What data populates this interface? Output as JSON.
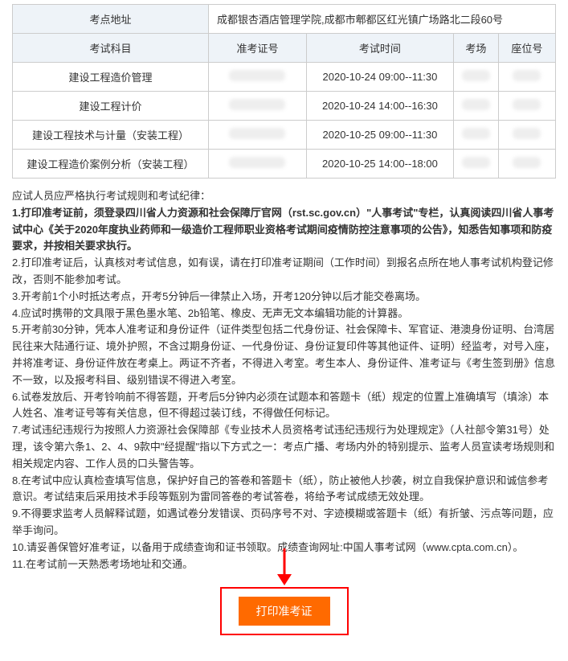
{
  "address_label": "考点地址",
  "address_value": "成都银杏酒店管理学院,成都市郫都区红光镇广场路北二段60号",
  "headers": {
    "subject": "考试科目",
    "ticket": "准考证号",
    "time": "考试时间",
    "room": "考场",
    "seat": "座位号"
  },
  "rows": [
    {
      "subject": "建设工程造价管理",
      "time": "2020-10-24 09:00--11:30"
    },
    {
      "subject": "建设工程计价",
      "time": "2020-10-24 14:00--16:30"
    },
    {
      "subject": "建设工程技术与计量（安装工程）",
      "time": "2020-10-25 09:00--11:30"
    },
    {
      "subject": "建设工程造价案例分析（安装工程）",
      "time": "2020-10-25 14:00--18:00"
    }
  ],
  "rules_intro": "应试人员应严格执行考试规则和考试纪律：",
  "rule1": "1.打印准考证前，须登录四川省人力资源和社会保障厅官网（rst.sc.gov.cn）\"人事考试\"专栏，认真阅读四川省人事考试中心《关于2020年度执业药师和一级造价工程师职业资格考试期间疫情防控注意事项的公告》，知悉告知事项和防疫要求，并按相关要求执行。",
  "rule2": "2.打印准考证后，认真核对考试信息，如有误，请在打印准考证期间（工作时间）到报名点所在地人事考试机构登记修改，否则不能参加考试。",
  "rule3": "3.开考前1个小时抵达考点，开考5分钟后一律禁止入场，开考120分钟以后才能交卷离场。",
  "rule4": "4.应试时携带的文具限于黑色墨水笔、2b铅笔、橡皮、无声无文本编辑功能的计算器。",
  "rule5": "5.开考前30分钟，凭本人准考证和身份证件（证件类型包括二代身份证、社会保障卡、军官证、港澳身份证明、台湾居民往来大陆通行证、境外护照，不含过期身份证、一代身份证、身份证复印件等其他证件、证明）经监考，对号入座，并将准考证、身份证件放在考桌上。两证不齐者，不得进入考室。考生本人、身份证件、准考证与《考生签到册》信息不一致，以及报考科目、级别错误不得进入考室。",
  "rule6": "6.试卷发放后、开考铃响前不得答题，开考后5分钟内必须在试题本和答题卡（纸）规定的位置上准确填写（填涂）本人姓名、准考证号等有关信息，但不得超过装订线，不得做任何标记。",
  "rule7": "7.考试违纪违规行为按照人力资源社会保障部《专业技术人员资格考试违纪违规行为处理规定》（人社部令第31号）处理，该令第六条1、2、4、9款中\"经提醒\"指以下方式之一：考点广播、考场内外的特别提示、监考人员宣读考场规则和相关规定内容、工作人员的口头警告等。",
  "rule8": "8.在考试中应认真检查填写信息，保护好自己的答卷和答题卡（纸），防止被他人抄袭，树立自我保护意识和诚信参考意识。考试结束后采用技术手段等甄别为雷同答卷的考试答卷，将给予考试成绩无效处理。",
  "rule9": "9.不得要求监考人员解释试题，如遇试卷分发错误、页码序号不对、字迹模糊或答题卡（纸）有折皱、污点等问题，应举手询问。",
  "rule10": "10.请妥善保管好准考证，以备用于成绩查询和证书领取。成绩查询网址:中国人事考试网（www.cpta.com.cn）。",
  "rule11": "11.在考试前一天熟悉考场地址和交通。",
  "print_label": "打印准考证"
}
